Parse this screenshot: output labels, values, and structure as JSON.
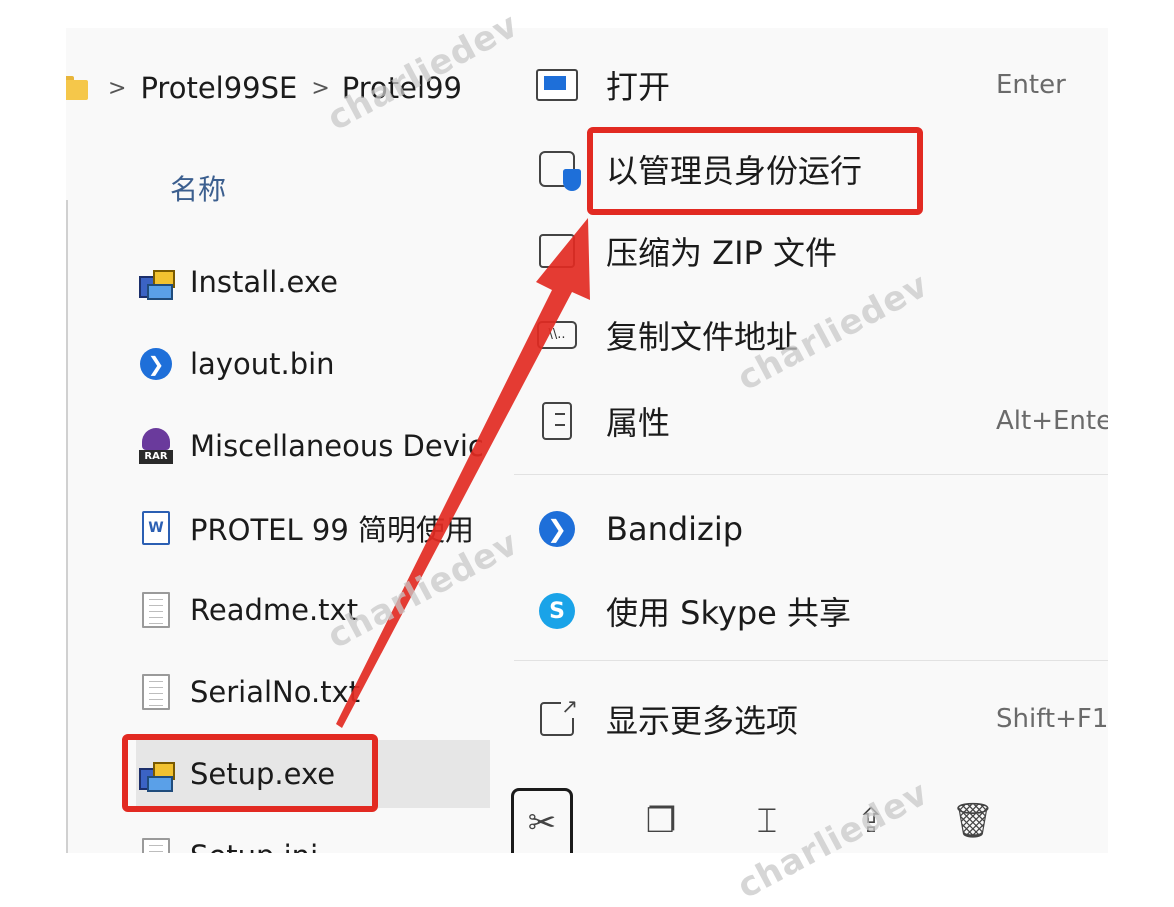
{
  "breadcrumb": {
    "items": [
      "Protel99SE",
      "Protel99"
    ],
    "separator": ">"
  },
  "file_list": {
    "column_header": "名称",
    "files": [
      {
        "name": "Install.exe",
        "icon": "installer-icon"
      },
      {
        "name": "layout.bin",
        "icon": "bandizip-file-icon"
      },
      {
        "name": "Miscellaneous Devic",
        "icon": "rar-archive-icon"
      },
      {
        "name": "PROTEL 99 简明使用",
        "icon": "word-document-icon"
      },
      {
        "name": "Readme.txt",
        "icon": "text-file-icon"
      },
      {
        "name": "SerialNo.txt",
        "icon": "text-file-icon"
      },
      {
        "name": "Setup.exe",
        "icon": "installer-icon",
        "selected": true
      },
      {
        "name": "Setup.ini",
        "icon": "text-file-icon"
      }
    ]
  },
  "context_menu": {
    "items": [
      {
        "label": "打开",
        "shortcut": "Enter",
        "icon": "open-window-icon"
      },
      {
        "label": "以管理员身份运行",
        "shortcut": "",
        "icon": "admin-shield-icon"
      },
      {
        "label": "压缩为 ZIP 文件",
        "shortcut": "",
        "icon": "zip-folder-icon"
      },
      {
        "label": "复制文件地址",
        "shortcut": "",
        "icon": "copy-path-icon"
      },
      {
        "label": "属性",
        "shortcut": "Alt+Ente",
        "icon": "properties-icon"
      },
      {
        "label": "Bandizip",
        "shortcut": "",
        "icon": "bandizip-icon"
      },
      {
        "label": "使用 Skype 共享",
        "shortcut": "",
        "icon": "skype-icon"
      },
      {
        "label": "显示更多选项",
        "shortcut": "Shift+F1",
        "icon": "show-more-icon"
      }
    ],
    "toolbar": [
      "cut-icon",
      "copy-icon",
      "rename-icon",
      "share-icon",
      "delete-icon"
    ],
    "path_icon_text": "\\\\.."
  },
  "annotation": {
    "color": "#e22a22",
    "watermark": "charliedev"
  },
  "icons": {
    "cut": "✂",
    "copy": "❐",
    "rename": "⌶",
    "share": "⇪",
    "delete": "🗑",
    "bin": "❯",
    "skype": "S",
    "doc": "W",
    "rar": "RAR"
  }
}
